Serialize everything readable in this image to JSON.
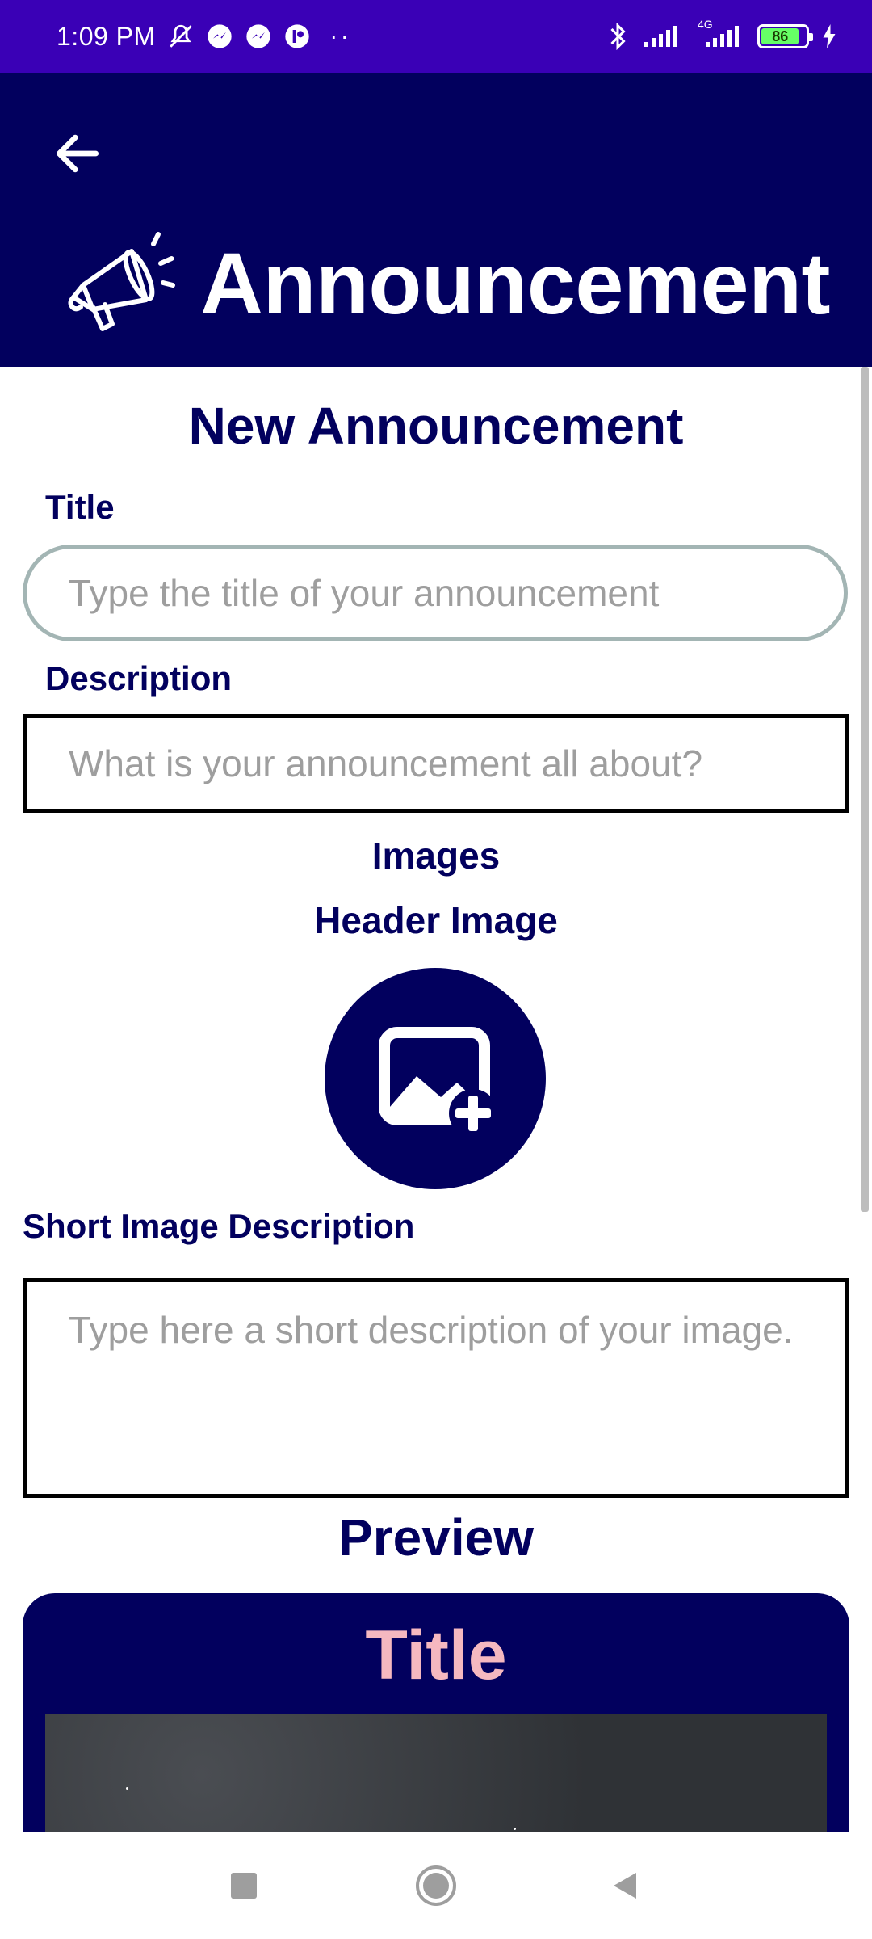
{
  "status_bar": {
    "time": "1:09 PM",
    "battery_level": "86",
    "network_label": "4G",
    "dots": "··"
  },
  "header": {
    "title": "Announcement"
  },
  "form": {
    "heading": "New Announcement",
    "title_label": "Title",
    "title_placeholder": "Type the title of your announcement",
    "description_label": "Description",
    "description_placeholder": "What is your announcement all about?",
    "images_label": "Images",
    "header_image_label": "Header Image",
    "short_image_description_label": "Short Image Description",
    "short_image_description_placeholder": "Type here a short description of your image.",
    "preview_label": "Preview"
  },
  "preview": {
    "title": "Title"
  },
  "colors": {
    "status_bar": "#3a00b6",
    "primary": "#02005e",
    "preview_title": "#f5b8c0",
    "input_outline": "#a3b5b4"
  }
}
